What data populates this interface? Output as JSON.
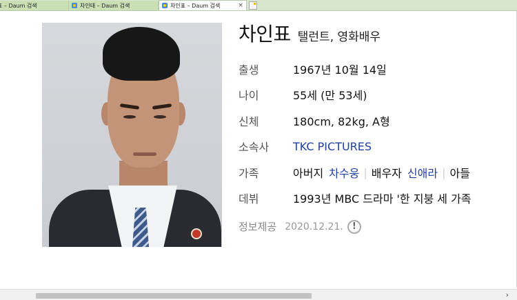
{
  "tabs": [
    {
      "label": "표 – Daum 검색",
      "active": false
    },
    {
      "label": "차인태 – Daum 검색",
      "active": false
    },
    {
      "label": "차인표 – Daum 검색",
      "active": true
    }
  ],
  "tab_close": "×",
  "profile": {
    "name": "차인표",
    "job": "탤런트, 영화배우",
    "rows": [
      {
        "label": "출생",
        "value": "1967년 10월 14일"
      },
      {
        "label": "나이",
        "value": "55세 (만 53세)"
      },
      {
        "label": "신체",
        "value": "180cm, 82kg, A형"
      },
      {
        "label": "소속사",
        "value": "TKC PICTURES"
      },
      {
        "label": "가족"
      },
      {
        "label": "데뷔",
        "value": "1993년 MBC 드라마 '한 지붕 세 가족"
      }
    ],
    "family": [
      {
        "relation": "아버지",
        "name": "차수웅"
      },
      {
        "relation": "배우자",
        "name": "신애라"
      },
      {
        "relation": "아들"
      }
    ],
    "provided_label": "정보제공",
    "provided_date": "2020.12.21.",
    "alert_glyph": "!"
  },
  "scroll_arrow": "›",
  "colors": {
    "link": "#1f3fa5",
    "label": "#555555",
    "tabbar": "#d9e6cf"
  }
}
